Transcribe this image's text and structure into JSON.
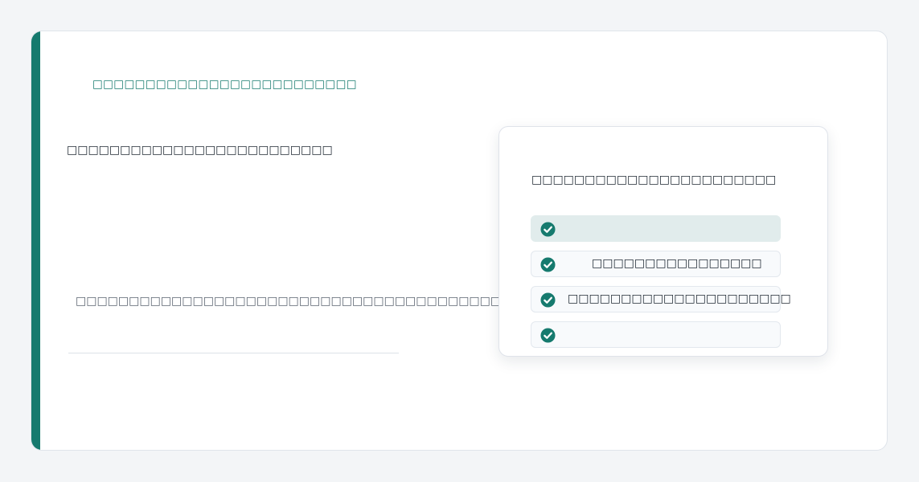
{
  "header": {
    "eyebrow": "□□□□□□□□□□□□□□□□□□□□□□□□□",
    "heading": "□□□□□□□□□□□□□□□□□□□□□□□□□"
  },
  "body": {
    "text": "□□□□□□□□□□□□□□□□□□□□□□□□□□□□□□□□□□□□□□□□□□"
  },
  "checklist": {
    "title": "□□□□□□□□□□□□□□□□□□□□□□□",
    "items": [
      {
        "label": ""
      },
      {
        "label": "□□□□□□□□□□□□□□□□"
      },
      {
        "label": "□□□□□□□□□□□□□□□□□□□□□"
      },
      {
        "label": ""
      }
    ]
  },
  "colors": {
    "accent": "#167a6e",
    "selected_row": "#e1ecec"
  },
  "icons": {
    "item_icon": "check-circle-icon"
  }
}
